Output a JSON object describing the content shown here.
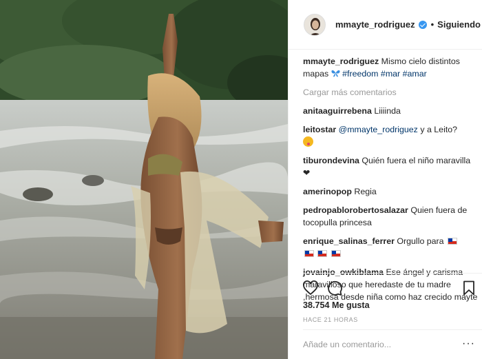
{
  "post": {
    "username": "mmayte_rodriguez",
    "dot": "•",
    "follow_status": "Siguiendo",
    "verified_icon": "verified-badge-icon"
  },
  "caption": {
    "username": "mmayte_rodriguez",
    "text": "Mismo cielo distintos mapas",
    "tags": [
      "#freedom",
      "#mar",
      "#amar"
    ]
  },
  "load_more": "Cargar más comentarios",
  "comments": [
    {
      "user": "anitaaguirrebena",
      "text": "Liiiinda"
    },
    {
      "user": "leitostar",
      "mention": "@mmayte_rodriguez",
      "text": "y a Leito?"
    },
    {
      "user": "tiburondevina",
      "text": "Quién fuera el niño maravilla"
    },
    {
      "user": "amerinopop",
      "text": "Regia"
    },
    {
      "user": "pedropablorobertosalazar",
      "text": "Quien fuera de tocopulla princesa"
    },
    {
      "user": "enrique_salinas_ferrer",
      "text": "Orgullo para"
    },
    {
      "user": "jovainjo_owkiblama",
      "text": "Ese ángel y carisma maravilloso que heredaste de tu madre ,hermosa desde niña como haz crecido mayte"
    }
  ],
  "likes": "38.754 Me gusta",
  "time": "HACE 21 HORAS",
  "add_comment_placeholder": "Añade un comentario...",
  "more_options": "···",
  "icons": {
    "like": "heart-icon",
    "comment": "comment-icon",
    "save": "bookmark-icon"
  },
  "colors": {
    "link": "#003569",
    "muted": "#999999",
    "verified": "#3897f0",
    "border": "#efefef"
  }
}
